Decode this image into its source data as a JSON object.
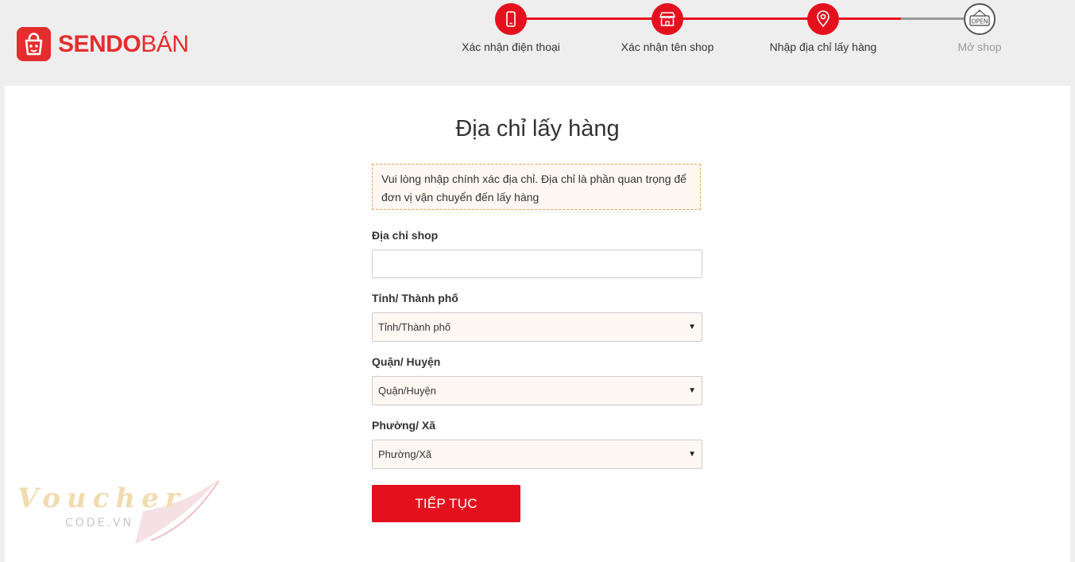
{
  "brand": {
    "logo_bold": "SENDO",
    "logo_light": "BÁN",
    "accent": "#e5101d"
  },
  "steps": [
    {
      "label": "Xác nhận điện thoại",
      "icon": "phone-icon",
      "state": "done"
    },
    {
      "label": "Xác nhận tên shop",
      "icon": "store-icon",
      "state": "done"
    },
    {
      "label": "Nhập địa chỉ lấy hàng",
      "icon": "location-pin-icon",
      "state": "current"
    },
    {
      "label": "Mở shop",
      "icon": "open-sign-icon",
      "state": "pending"
    }
  ],
  "form": {
    "title": "Địa chỉ lấy hàng",
    "notice": "Vui lòng nhập chính xác địa chỉ. Địa chỉ là phần quan trọng để đơn vị vận chuyển đến lấy hàng",
    "address_label": "Địa chỉ shop",
    "address_value": "",
    "province_label": "Tỉnh/ Thành phố",
    "province_value": "Tỉnh/Thành phố",
    "district_label": "Quận/ Huyện",
    "district_value": "Quận/Huyện",
    "ward_label": "Phường/ Xã",
    "ward_value": "Phường/Xã",
    "submit_label": "TIẾP TỤC"
  },
  "watermark": {
    "text_top": "Voucher",
    "text_bottom": "CODE.VN"
  }
}
